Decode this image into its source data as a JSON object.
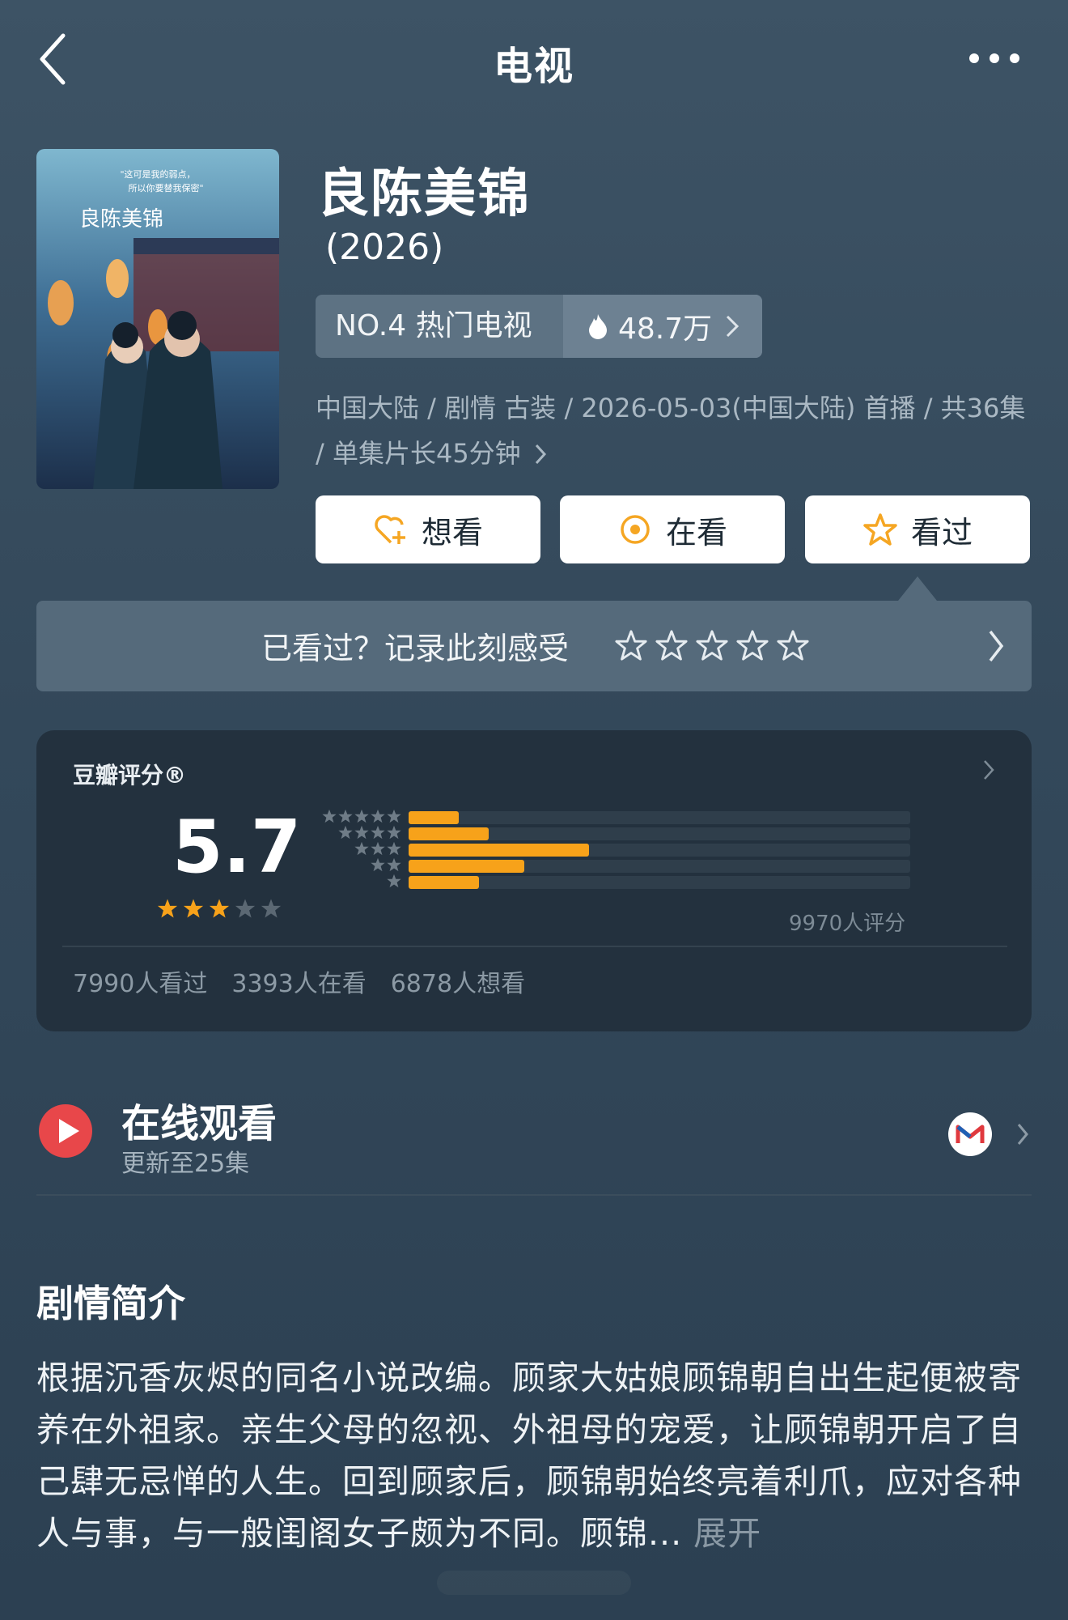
{
  "header": {
    "title": "电视"
  },
  "show": {
    "title": "良陈美锦",
    "year": "(2026)",
    "rank_label": "NO.4 热门电视",
    "heat_value": "48.7万",
    "meta": "中国大陆 / 剧情 古装 / 2026-05-03(中国大陆) 首播 / 共36集 / 单集片长45分钟",
    "poster_text": "良陈美锦"
  },
  "actions": {
    "wish_label": "想看",
    "doing_label": "在看",
    "done_label": "看过"
  },
  "record": {
    "prompt": "已看过？记录此刻感受"
  },
  "rating": {
    "label": "豆瓣评分®",
    "score": "5.7",
    "score_stars": 3,
    "distribution_fraction": [
      0.1,
      0.16,
      0.36,
      0.23,
      0.14
    ],
    "votes": "9970人评分",
    "watched": "7990人看过",
    "watching": "3393人在看",
    "wish": "6878人想看"
  },
  "online": {
    "title": "在线观看",
    "subtitle": "更新至25集"
  },
  "synopsis": {
    "heading": "剧情简介",
    "body": "根据沉香灰烬的同名小说改编。顾家大姑娘顾锦朝自出生起便被寄养在外祖家。亲生父母的忽视、外祖母的宠爱，让顾锦朝开启了自己肆无忌惮的人生。回到顾家后，顾锦朝始终亮着利爪，应对各种人与事，与一般闺阁女子颇为不同。顾锦...",
    "expand_label": "展开"
  },
  "colors": {
    "accent": "#f7a21a",
    "background": "#33485a",
    "play_red": "#e8474a"
  }
}
